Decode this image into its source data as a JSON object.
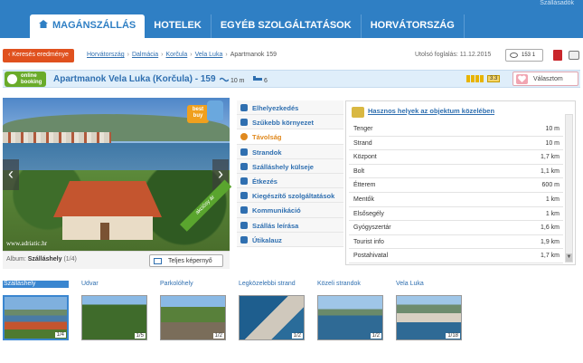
{
  "topbar": {
    "top_right": "Szállásadók",
    "tabs": [
      "MAGÁNSZÁLLÁS",
      "HOTELEK",
      "EGYÉB SZOLGÁLTATÁSOK",
      "HORVÁTORSZÁG"
    ]
  },
  "breadcrumb": {
    "back_label": "‹ Keresés eredménye",
    "items": [
      "Horvátország",
      "Dalmácia",
      "Korčula",
      "Vela Luka"
    ],
    "current": "Apartmanok 159",
    "separator": "›"
  },
  "last_booking": "Utolsó foglalás: 11.12.2015",
  "views": {
    "count": "153",
    "badge": "1"
  },
  "property": {
    "online_label_1": "online",
    "online_label_2": "booking",
    "title": "Apartmanok Vela Luka (Korčula) - 159",
    "distance_sea": "10 m",
    "beds": "6",
    "rating": "3.3",
    "select_label": "Választom"
  },
  "gallery": {
    "best_buy": "best buy",
    "ribbon": "akciósy ár",
    "watermark": "www.adriatic.hr",
    "album_label": "Album:",
    "album_name": "Szálláshely",
    "album_count": "(1/4)",
    "fullscreen_label": "Teljes képernyő"
  },
  "menu": [
    "Elhelyezkedés",
    "Szűkebb környezet",
    "Távolság",
    "Strandok",
    "Szálláshely külseje",
    "Étkezés",
    "Kiegészítő szolgáltatások",
    "Kommunikáció",
    "Szállás leírása",
    "Útikalauz"
  ],
  "distances": {
    "heading": "Hasznos helyek az objektum közelében",
    "rows": [
      {
        "name": "Tenger",
        "value": "10 m"
      },
      {
        "name": "Strand",
        "value": "10 m"
      },
      {
        "name": "Központ",
        "value": "1,7 km"
      },
      {
        "name": "Bolt",
        "value": "1,1 km"
      },
      {
        "name": "Étterem",
        "value": "600 m"
      },
      {
        "name": "Mentők",
        "value": "1 km"
      },
      {
        "name": "Elsősegély",
        "value": "1 km"
      },
      {
        "name": "Gyógyszertár",
        "value": "1,6 km"
      },
      {
        "name": "Tourist info",
        "value": "1,9 km"
      },
      {
        "name": "Postahivatal",
        "value": "1,7 km"
      }
    ]
  },
  "thumbnails": [
    {
      "label": "Szálláshely",
      "count": "1/4"
    },
    {
      "label": "Udvar",
      "count": "1/5"
    },
    {
      "label": "Parkolóhely",
      "count": "1/2"
    },
    {
      "label": "Legközelebbi strand",
      "count": "1/2"
    },
    {
      "label": "Közeli strandok",
      "count": "1/2"
    },
    {
      "label": "Vela Luka",
      "count": "1/18"
    }
  ]
}
